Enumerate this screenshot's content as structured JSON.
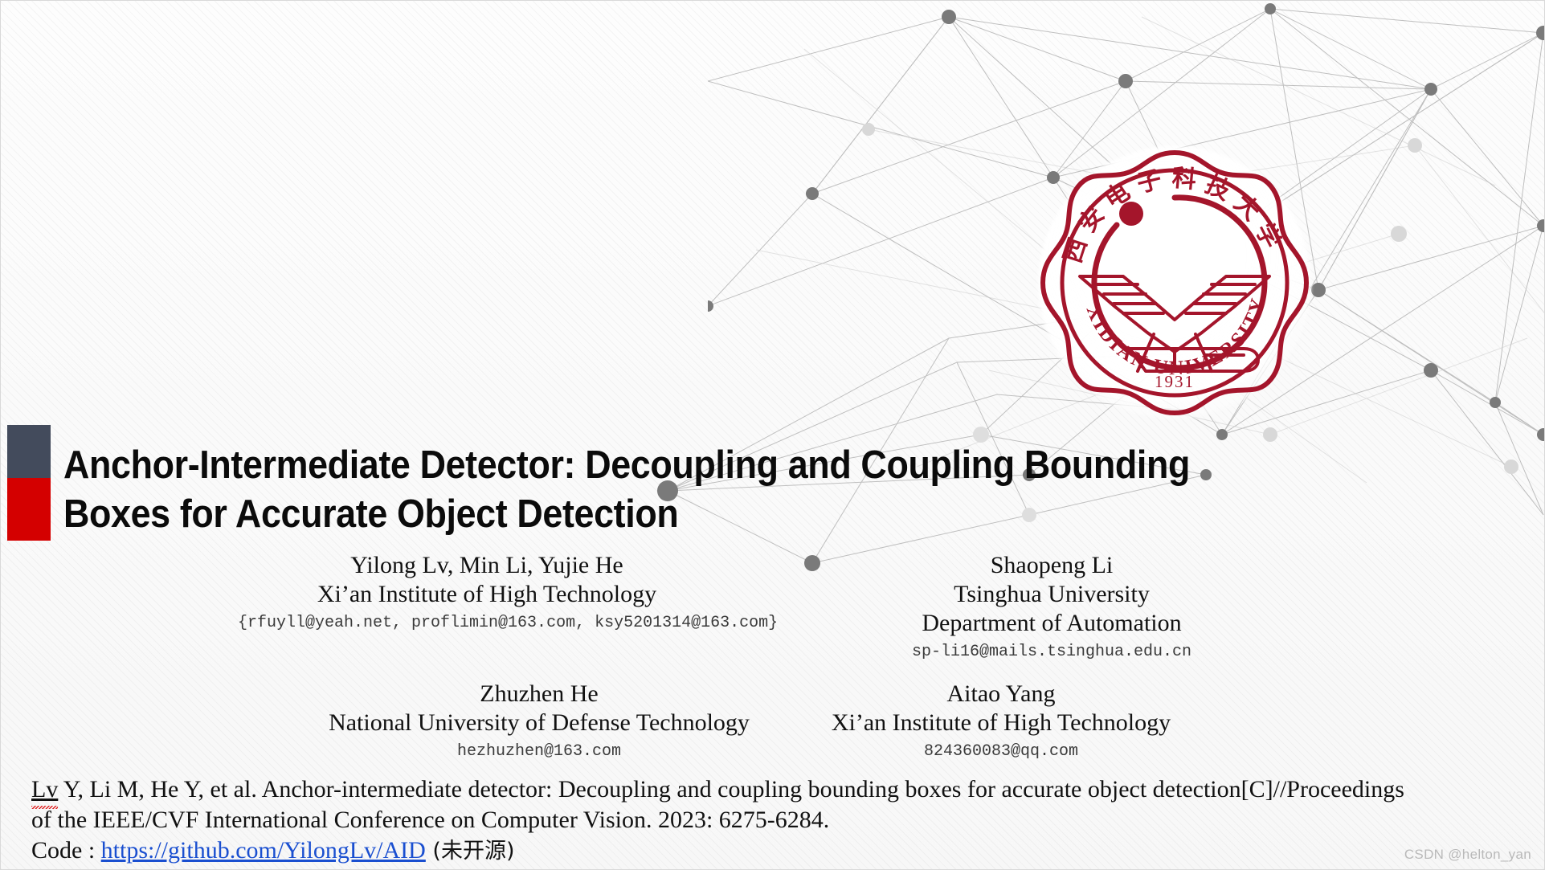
{
  "slide": {
    "accent": {
      "top_color": "#434b5c",
      "bottom_color": "#d40000"
    },
    "background_color": "#fbfbfb",
    "title": "Anchor-Intermediate Detector: Decoupling and Coupling Bounding Boxes for Accurate Object Detection"
  },
  "logo": {
    "institution_cn": "西安电子科技大学",
    "institution_en": "XIDIAN UNIVERSITY",
    "founded_year": "1931",
    "color": "#a4152b"
  },
  "authors": [
    {
      "name": "Yilong Lv, Min Li, Yujie He",
      "affiliation": "Xi’an Institute of High Technology",
      "affiliation_line2": "",
      "email": "{rfuyll@yeah.net, proflimin@163.com, ksy5201314@163.com}"
    },
    {
      "name": "Shaopeng Li",
      "affiliation": "Tsinghua University",
      "affiliation_line2": "Department of Automation",
      "email": "sp-li16@mails.tsinghua.edu.cn"
    },
    {
      "name": "Zhuzhen He",
      "affiliation": "National University of Defense Technology",
      "affiliation_line2": "",
      "email": "hezhuzhen@163.com"
    },
    {
      "name": "Aitao Yang",
      "affiliation": "Xi’an Institute of High Technology",
      "affiliation_line2": "",
      "email": "824360083@qq.com"
    }
  ],
  "citation": {
    "misspelled_word": "Lv",
    "line1_rest": " Y, Li M, He Y, et al. Anchor-intermediate detector: Decoupling and coupling bounding boxes for accurate object detection[C]//Proceedings",
    "line2": "of the IEEE/CVF International Conference on Computer Vision. 2023: 6275-6284.",
    "code_label": "Code : ",
    "code_url": "https://github.com/YilongLv/AID",
    "code_note": "(未开源)"
  },
  "watermark": "CSDN @helton_yan"
}
